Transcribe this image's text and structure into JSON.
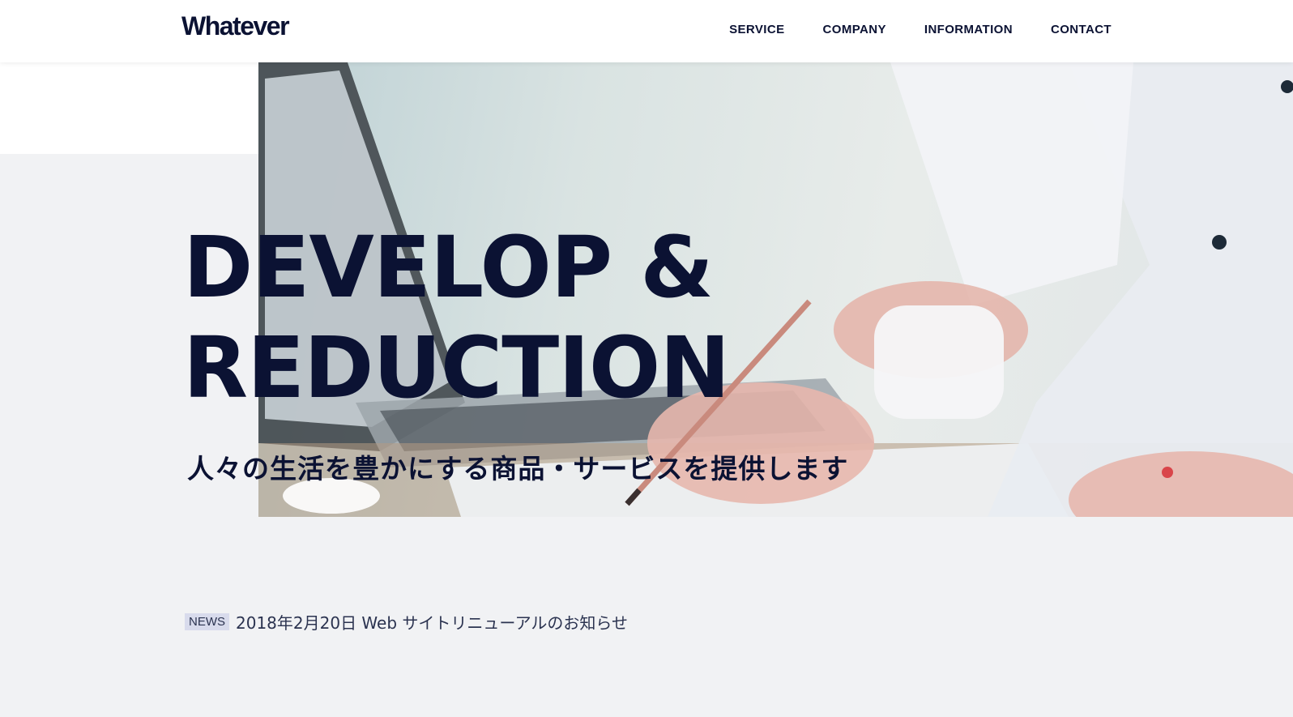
{
  "header": {
    "logo": "Whatever",
    "nav": [
      {
        "label": "SERVICE"
      },
      {
        "label": "COMPANY"
      },
      {
        "label": "INFORMATION"
      },
      {
        "label": "CONTACT"
      }
    ]
  },
  "hero": {
    "title_line1": "DEVELOP &",
    "title_line2": "REDUCTION",
    "subtitle": "人々の生活を豊かにする商品・サービスを提供します"
  },
  "news": {
    "badge": "NEWS",
    "text": "2018年2月20日 Web サイトリニューアルのお知らせ"
  },
  "colors": {
    "navy": "#0b1233",
    "background": "#f1f2f4",
    "badge_bg": "#d8dbec"
  }
}
